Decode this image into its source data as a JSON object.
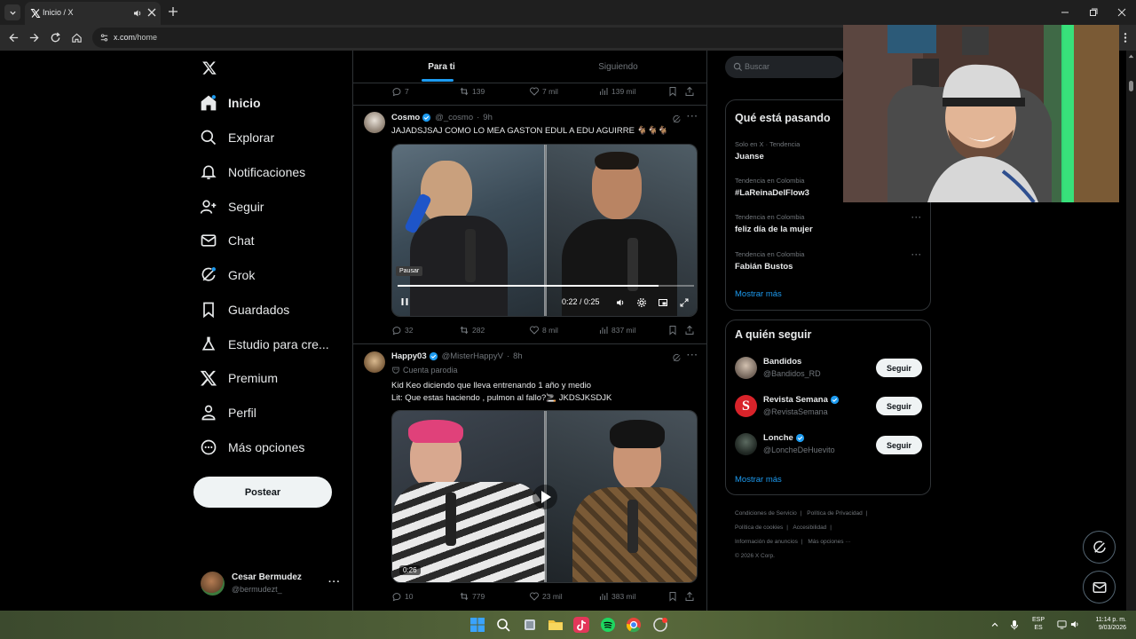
{
  "browser": {
    "tab_title": "Inicio / X",
    "url_host": "x.com",
    "url_path": "/home"
  },
  "nav": {
    "items": [
      {
        "label": "Inicio",
        "icon": "home-icon"
      },
      {
        "label": "Explorar",
        "icon": "search-icon"
      },
      {
        "label": "Notificaciones",
        "icon": "bell-icon"
      },
      {
        "label": "Seguir",
        "icon": "person-add-icon"
      },
      {
        "label": "Chat",
        "icon": "mail-icon"
      },
      {
        "label": "Grok",
        "icon": "grok-icon"
      },
      {
        "label": "Guardados",
        "icon": "bookmark-icon"
      },
      {
        "label": "Estudio para cre...",
        "icon": "flask-icon"
      },
      {
        "label": "Premium",
        "icon": "x-icon"
      },
      {
        "label": "Perfil",
        "icon": "person-icon"
      },
      {
        "label": "Más opciones",
        "icon": "more-circle-icon"
      }
    ],
    "post_button": "Postear",
    "account": {
      "name": "Cesar Bermudez",
      "handle": "@bermudezt_"
    }
  },
  "timeline": {
    "tabs": [
      "Para ti",
      "Siguiendo"
    ],
    "top_actions": {
      "replies": "7",
      "reposts": "139",
      "likes": "7 mil",
      "views": "139 mil"
    },
    "tweets": [
      {
        "name": "Cosmo",
        "handle": "@_cosmo",
        "time": "9h",
        "text": "JAJADSJSAJ COMO LO MEA GASTON EDUL A EDU AGUIRRE 🐐🐐🐐",
        "video": {
          "tooltip": "Pausar",
          "time": "0:22 / 0:25"
        },
        "actions": {
          "replies": "32",
          "reposts": "282",
          "likes": "8 mil",
          "views": "837 mil"
        }
      },
      {
        "name": "Happy03",
        "handle": "@MisterHappyV",
        "time": "8h",
        "badge": "Cuenta parodia",
        "text_line1": "Kid Keo diciendo que lleva entrenando 1 año y medio",
        "text_line2": "Lit: Que estas haciendo , pulmon al fallo?🚬 JKDSJKSDJK",
        "video": {
          "time": "0:26"
        },
        "actions": {
          "replies": "10",
          "reposts": "779",
          "likes": "23 mil",
          "views": "383 mil"
        }
      }
    ]
  },
  "sidebar": {
    "search_placeholder": "Buscar",
    "trends_title": "Qué está pasando",
    "trends": [
      {
        "meta": "Solo en X · Tendencia",
        "name": "Juanse"
      },
      {
        "meta": "Tendencia en Colombia",
        "name": "#LaReinaDelFlow3"
      },
      {
        "meta": "Tendencia en Colombia",
        "name": "feliz día de la mujer"
      },
      {
        "meta": "Tendencia en Colombia",
        "name": "Fabián Bustos"
      }
    ],
    "show_more": "Mostrar más",
    "follow_title": "A quién seguir",
    "follow": [
      {
        "name": "Bandidos",
        "handle": "@Bandidos_RD",
        "button": "Seguir",
        "verified": false
      },
      {
        "name": "Revista Semana",
        "handle": "@RevistaSemana",
        "button": "Seguir",
        "verified": true
      },
      {
        "name": "Lonche",
        "handle": "@LoncheDeHuevito",
        "button": "Seguir",
        "verified": true
      }
    ],
    "footer": [
      "Condiciones de Servicio",
      "Política de Privacidad",
      "Política de cookies",
      "Accesibilidad",
      "Información de anuncios",
      "Más opciones ···",
      "© 2026 X Corp."
    ]
  },
  "taskbar": {
    "lang_top": "ESP",
    "lang_bottom": "ES",
    "time": "11:14 p. m.",
    "date": "9/03/2026"
  },
  "colors": {
    "accent": "#1d9bf0",
    "background": "#000000",
    "border": "#2f3336",
    "muted": "#71767b"
  }
}
